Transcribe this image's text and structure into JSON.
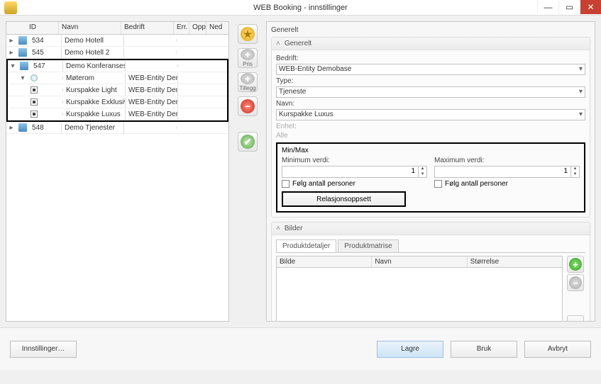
{
  "window": {
    "title": "WEB Booking - innstillinger"
  },
  "tree": {
    "headers": {
      "id": "ID",
      "navn": "Navn",
      "bedrift": "Bedrift",
      "err": "Err.",
      "opp": "Opp",
      "ned": "Ned"
    },
    "rows": [
      {
        "id": "534",
        "navn": "Demo Hotell",
        "bedrift": ""
      },
      {
        "id": "545",
        "navn": "Demo Hotell 2",
        "bedrift": ""
      },
      {
        "id": "547",
        "navn": "Demo Konferansesenter",
        "bedrift": ""
      },
      {
        "id": "",
        "navn": "Møterom",
        "bedrift": "WEB-Entity Demobase"
      },
      {
        "id": "",
        "navn": "Kurspakke Light",
        "bedrift": "WEB-Entity Demobase"
      },
      {
        "id": "",
        "navn": "Kurspakke Exklusive",
        "bedrift": "WEB-Entity Demobase"
      },
      {
        "id": "",
        "navn": "Kurspakke Luxus",
        "bedrift": "WEB-Entity Demobase"
      },
      {
        "id": "548",
        "navn": "Demo Tjenester",
        "bedrift": ""
      }
    ]
  },
  "toolbar": {
    "pris": "Pris",
    "tillegg": "Tillegg"
  },
  "right": {
    "title": "Generelt",
    "group_generelt": "Generelt",
    "bedrift_lbl": "Bedrift:",
    "bedrift_val": "WEB-Entity Demobase",
    "type_lbl": "Type:",
    "type_val": "Tjeneste",
    "navn_lbl": "Navn:",
    "navn_val": "Kurspakke Luxus",
    "enhet_lbl": "Enhet:",
    "enhet_val": "Alle",
    "minmax_hdr": "Min/Max",
    "min_lbl": "Minimum verdi:",
    "max_lbl": "Maximum verdi:",
    "min_val": "1",
    "max_val": "1",
    "folg": "Følg antall personer",
    "rel_btn": "Relasjonsoppsett",
    "group_bilder": "Bilder",
    "tab1": "Produktdetaljer",
    "tab2": "Produktmatrise",
    "img_cols": {
      "bilde": "Bilde",
      "navn": "Navn",
      "storrelse": "Størrelse"
    }
  },
  "footer": {
    "innstillinger": "Innstillinger…",
    "lagre": "Lagre",
    "bruk": "Bruk",
    "avbryt": "Avbryt"
  }
}
